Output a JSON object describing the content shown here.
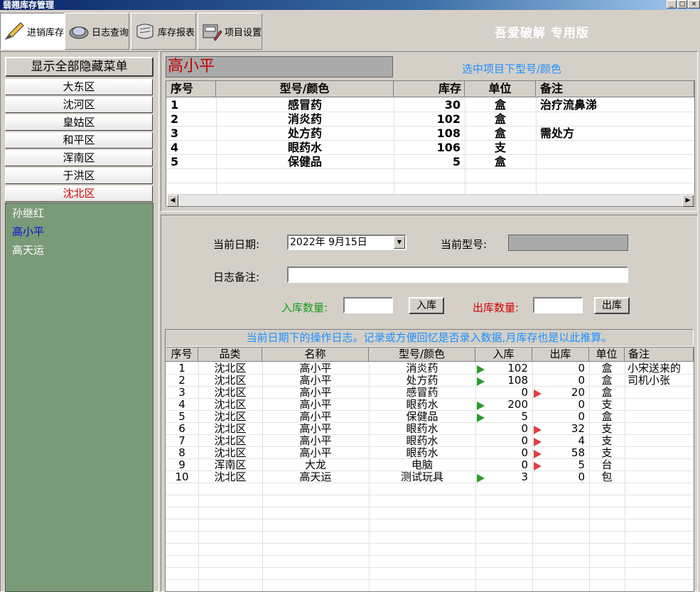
{
  "window": {
    "title": "翡翘库存管理",
    "brand": "吾爱破解 专用版"
  },
  "toolbar": [
    {
      "label": "进销库存",
      "icon": "pencil-icon",
      "active": true
    },
    {
      "label": "日志查询",
      "icon": "magnifier-icon",
      "active": false
    },
    {
      "label": "库存报表",
      "icon": "scroll-icon",
      "active": false
    },
    {
      "label": "项目设置",
      "icon": "tools-icon",
      "active": false
    }
  ],
  "left": {
    "show_all": "显示全部隐藏菜单",
    "districts": [
      "大东区",
      "沈河区",
      "皇姑区",
      "和平区",
      "浑南区",
      "于洪区",
      "沈北区"
    ],
    "selected_district": "沈北区",
    "names": [
      "孙继红",
      "高小平",
      "高天运"
    ],
    "selected_name": "高小平"
  },
  "top": {
    "selected_name": "高小平",
    "hint": "选中项目下型号/颜色",
    "columns": [
      "序号",
      "型号/颜色",
      "库存",
      "单位",
      "备注"
    ],
    "rows": [
      {
        "no": "1",
        "model": "感冒药",
        "stock": "30",
        "unit": "盒",
        "note": "治疗流鼻涕"
      },
      {
        "no": "2",
        "model": "消炎药",
        "stock": "102",
        "unit": "盒",
        "note": ""
      },
      {
        "no": "3",
        "model": "处方药",
        "stock": "108",
        "unit": "盒",
        "note": "需处方"
      },
      {
        "no": "4",
        "model": "眼药水",
        "stock": "106",
        "unit": "支",
        "note": ""
      },
      {
        "no": "5",
        "model": "保健品",
        "stock": "5",
        "unit": "盒",
        "note": ""
      }
    ]
  },
  "form": {
    "date_label": "当前日期:",
    "date_value": "2022年 9月15日",
    "model_label": "当前型号:",
    "note_label": "日志备注:",
    "in_label": "入库数量:",
    "in_button": "入库",
    "out_label": "出库数量:",
    "out_button": "出库"
  },
  "log": {
    "hint": "当前日期下的操作日志。记录或方便回忆是否录入数据,月库存也是以此推算。",
    "columns": [
      "序号",
      "品类",
      "名称",
      "型号/颜色",
      "入库",
      "出库",
      "单位",
      "备注"
    ],
    "rows": [
      {
        "no": "1",
        "cat": "沈北区",
        "name": "高小平",
        "model": "消炎药",
        "in": "102",
        "out": "0",
        "unit": "盒",
        "note": "小宋送来的",
        "mark": "in"
      },
      {
        "no": "2",
        "cat": "沈北区",
        "name": "高小平",
        "model": "处方药",
        "in": "108",
        "out": "0",
        "unit": "盒",
        "note": "司机小张",
        "mark": "in"
      },
      {
        "no": "3",
        "cat": "沈北区",
        "name": "高小平",
        "model": "感冒药",
        "in": "0",
        "out": "20",
        "unit": "盒",
        "note": "",
        "mark": "out"
      },
      {
        "no": "4",
        "cat": "沈北区",
        "name": "高小平",
        "model": "眼药水",
        "in": "200",
        "out": "0",
        "unit": "支",
        "note": "",
        "mark": "in"
      },
      {
        "no": "5",
        "cat": "沈北区",
        "name": "高小平",
        "model": "保健品",
        "in": "5",
        "out": "0",
        "unit": "盒",
        "note": "",
        "mark": "in"
      },
      {
        "no": "6",
        "cat": "沈北区",
        "name": "高小平",
        "model": "眼药水",
        "in": "0",
        "out": "32",
        "unit": "支",
        "note": "",
        "mark": "out"
      },
      {
        "no": "7",
        "cat": "沈北区",
        "name": "高小平",
        "model": "眼药水",
        "in": "0",
        "out": "4",
        "unit": "支",
        "note": "",
        "mark": "out"
      },
      {
        "no": "8",
        "cat": "沈北区",
        "name": "高小平",
        "model": "眼药水",
        "in": "0",
        "out": "58",
        "unit": "支",
        "note": "",
        "mark": "out"
      },
      {
        "no": "9",
        "cat": "浑南区",
        "name": "大龙",
        "model": "电脑",
        "in": "0",
        "out": "5",
        "unit": "台",
        "note": "",
        "mark": "out"
      },
      {
        "no": "10",
        "cat": "沈北区",
        "name": "高天运",
        "model": "测试玩具",
        "in": "3",
        "out": "0",
        "unit": "包",
        "note": "",
        "mark": "in"
      }
    ]
  }
}
